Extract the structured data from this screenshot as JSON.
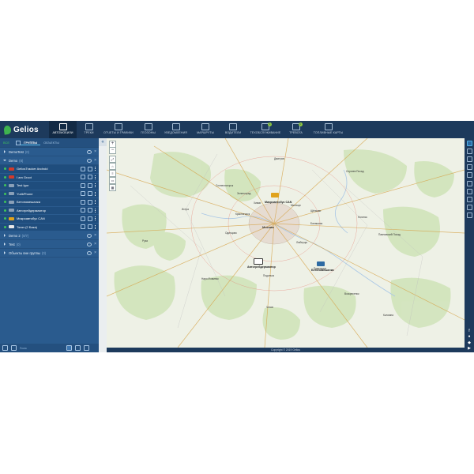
{
  "app": {
    "logo_text": "Gelios",
    "brand_color": "#1d3a5c",
    "accent_color": "#4fb1e8",
    "ok_color": "#3fc35a"
  },
  "nav": {
    "items": [
      {
        "label": "АВТОМОБИЛИ",
        "icon": "car-icon",
        "active": true
      },
      {
        "label": "ТРЕКИ",
        "icon": "track-icon"
      },
      {
        "label": "ОТЧЕТЫ И ГРАФИКИ",
        "icon": "reports-icon"
      },
      {
        "label": "ГЕОЗОНЫ",
        "icon": "geofence-icon"
      },
      {
        "label": "УВЕДОМЛЕНИЯ",
        "icon": "bell-icon"
      },
      {
        "label": "МАРШРУТЫ",
        "icon": "routes-icon"
      },
      {
        "label": "ВОДИТЕЛИ",
        "icon": "driver-icon"
      },
      {
        "label": "ТЕХОБСЛУЖИВАНИЕ",
        "icon": "wrench-icon",
        "badge": "1"
      },
      {
        "label": "ТРЕВОГА",
        "icon": "alarm-icon",
        "badge": "1"
      },
      {
        "label": "ТОПЛИВНЫЕ КАРТЫ",
        "icon": "fuel-card-icon"
      }
    ]
  },
  "sidebar": {
    "tabs": {
      "all": "ВСЕ",
      "groups": "ГРУППЫ",
      "objects": "ОБЪЕКТЫ"
    },
    "groups": [
      {
        "name": "DemoTest",
        "count": "(0)"
      },
      {
        "name": "Demo",
        "count": "(8)"
      }
    ],
    "vehicles": [
      {
        "name": "GeliosTracker Android",
        "icon_color": "#d23b2b"
      },
      {
        "name": "I am Groot",
        "icon_color": "#d23b2b"
      },
      {
        "name": "Test Igor",
        "icon_color": "#8aa0b8"
      },
      {
        "name": "YurikPhone",
        "icon_color": "#8aa0b8"
      },
      {
        "name": "Бетономешалка",
        "icon_color": "#8aa0b8"
      },
      {
        "name": "Автогрейдермаятор",
        "icon_color": "#8aa0b8"
      },
      {
        "name": "Микроавтобус CAN",
        "icon_color": "#e0a21c"
      },
      {
        "name": "Тягач (2 Бака)",
        "icon_color": "#e8e8e8"
      }
    ],
    "groups_after": [
      {
        "name": "Demo 2",
        "count": "(0/7)"
      },
      {
        "name": "Test",
        "count": "(0)"
      },
      {
        "name": "Объекты вне группы",
        "count": "(0)"
      }
    ],
    "search_placeholder": "Поиск"
  },
  "map": {
    "places": [
      "Красногорск",
      "Москва",
      "Мытищи",
      "Балашиха",
      "Химки",
      "Люберцы",
      "Подольск",
      "Одинцово",
      "Раменское",
      "Наро-Фоминск",
      "Дмитров",
      "Сергиев Посад",
      "Ногинск",
      "Павловский Посад",
      "Воскресенск",
      "Чехов",
      "Солнечногорск",
      "Истра",
      "Руза",
      "Зеленоград",
      "Щёлково",
      "Коломна"
    ],
    "vehicle_labels": [
      "Микроавтобус CAN",
      "Автогрейдермаятор",
      "Бетономешалка"
    ],
    "copyright": "Copyright © 2019 Gelios"
  }
}
